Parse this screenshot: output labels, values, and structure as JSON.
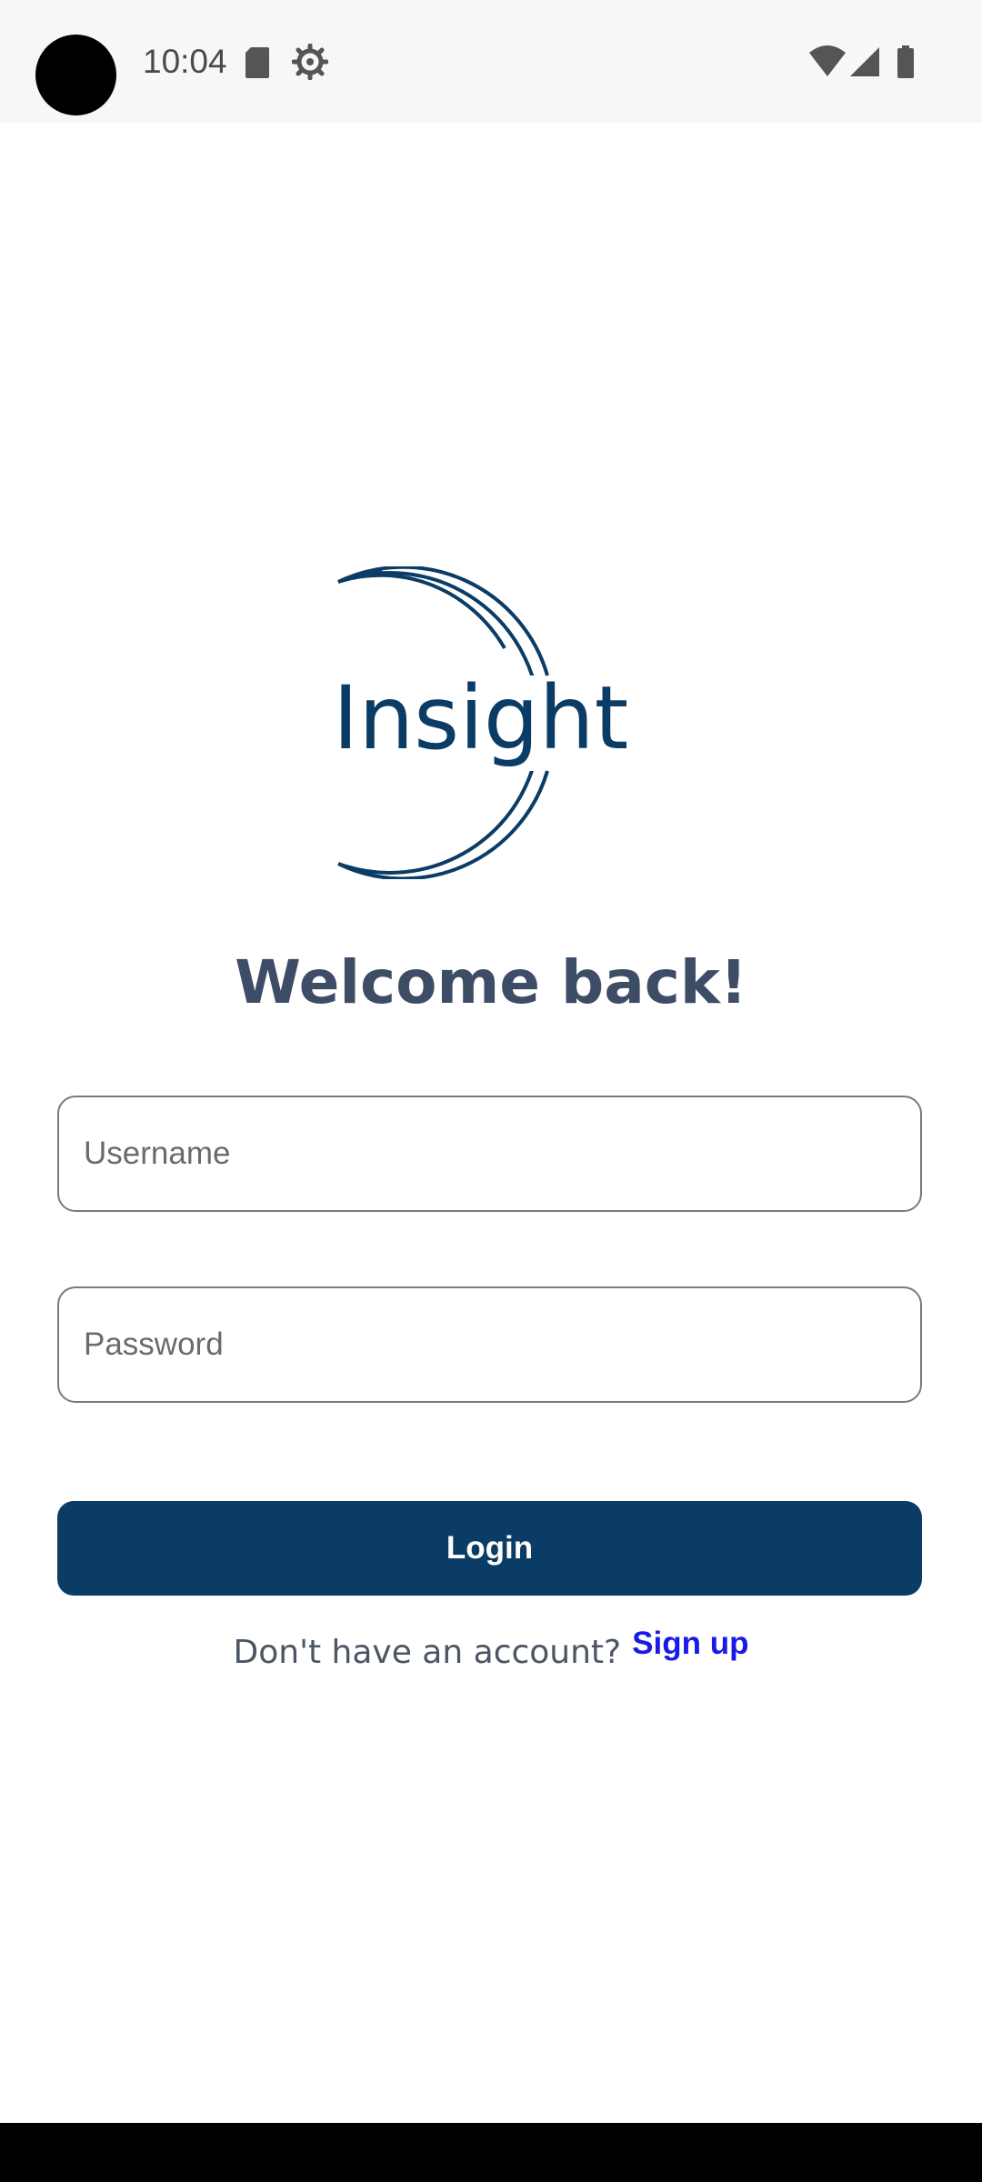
{
  "status_bar": {
    "time": "10:04",
    "icons": [
      "sd-card-icon",
      "settings-icon",
      "wifi-icon",
      "signal-icon",
      "battery-icon"
    ]
  },
  "logo": {
    "text": "Insight",
    "color": "#0b3c66"
  },
  "welcome": {
    "title": "Welcome back!"
  },
  "form": {
    "username_placeholder": "Username",
    "password_placeholder": "Password",
    "login_label": "Login"
  },
  "signup": {
    "prompt": "Don't have an account?",
    "link_label": "Sign up"
  },
  "colors": {
    "primary": "#0b3c66",
    "heading": "#3e4d66",
    "link": "#1a1ae6"
  }
}
